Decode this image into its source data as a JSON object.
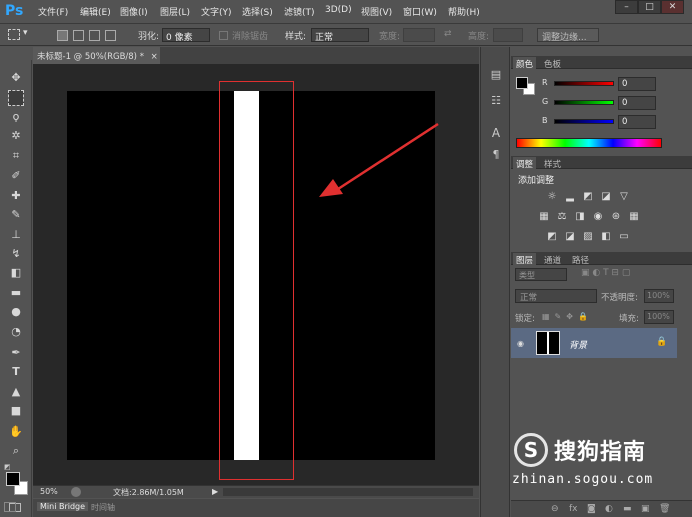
{
  "app": {
    "logo": "Ps"
  },
  "menu": [
    "文件(F)",
    "编辑(E)",
    "图像(I)",
    "图层(L)",
    "文字(Y)",
    "选择(S)",
    "滤镜(T)",
    "3D(D)",
    "视图(V)",
    "窗口(W)",
    "帮助(H)"
  ],
  "window_controls": {
    "minimize": "–",
    "maximize": "□",
    "close": "✕"
  },
  "options": {
    "feather_label": "羽化:",
    "feather_value": "0 像素",
    "antialias_label": "消除锯齿",
    "style_label": "样式:",
    "style_value": "正常",
    "width_label": "宽度:",
    "height_label": "高度:",
    "refine_edge": "调整边缘..."
  },
  "document": {
    "tab_title": "未标题-1 @ 50%(RGB/8) *",
    "tab_close": "×",
    "zoom": "50%",
    "doc_info": "文档:2.86M/1.05M"
  },
  "bottom_tabs": [
    "Mini Bridge",
    "时间轴"
  ],
  "color_panel": {
    "tabs": [
      "颜色",
      "色板"
    ],
    "channels": [
      {
        "label": "R",
        "value": "0",
        "gradient": "#ff0000"
      },
      {
        "label": "G",
        "value": "0",
        "gradient": "#00ff00"
      },
      {
        "label": "B",
        "value": "0",
        "gradient": "#0000ff"
      }
    ]
  },
  "adjust_panel": {
    "tabs": [
      "调整",
      "样式"
    ],
    "title": "添加调整"
  },
  "layers_panel": {
    "tabs": [
      "图层",
      "通道",
      "路径"
    ],
    "filter_kind": "类型",
    "blend_mode": "正常",
    "opacity_label": "不透明度:",
    "opacity_value": "100%",
    "lock_label": "锁定:",
    "fill_label": "填充:",
    "fill_value": "100%",
    "layer_name": "背景"
  },
  "watermark": {
    "brand": "搜狗指南",
    "url": "zhinan.sogou.com"
  },
  "colors": {
    "accent": "#31a8ff",
    "annotation": "#e03030",
    "selected_layer": "#5b6a83"
  }
}
